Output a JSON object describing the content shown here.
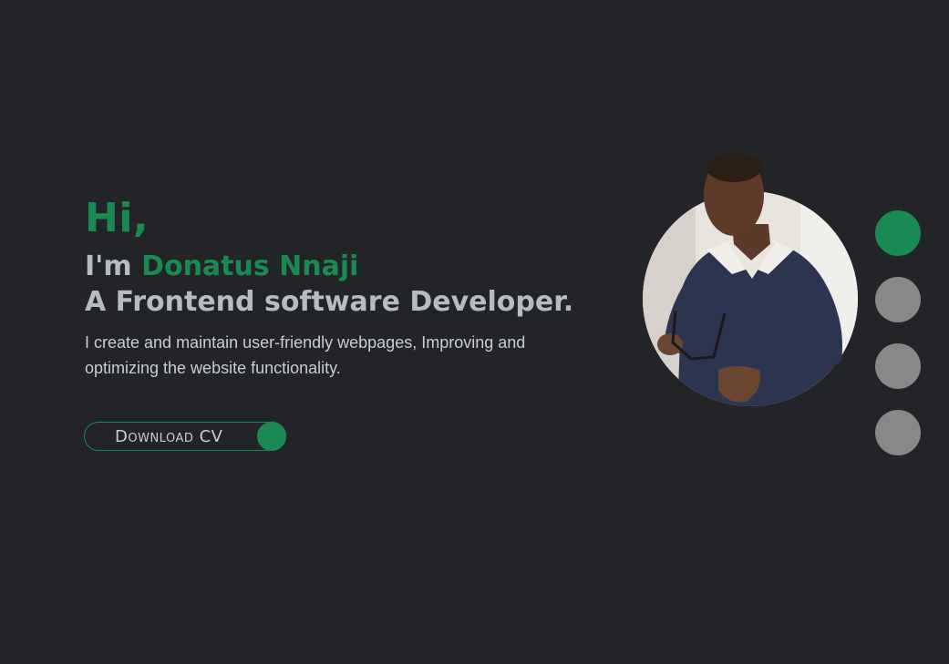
{
  "hero": {
    "greeting": "Hi,",
    "intro_prefix": "I'm",
    "name": "Donatus Nnaji",
    "role": "A Frontend software Developer.",
    "description": "I create and maintain user-friendly webpages, Improving and optimizing the website functionality."
  },
  "cta": {
    "label": "Download CV"
  },
  "profile_photo": {
    "alt": "Donatus Nnaji"
  },
  "pagination": {
    "dots": 4,
    "active_index": 0
  },
  "colors": {
    "background": "#222428",
    "accent": "#1a8a52",
    "text": "#b7bcc2",
    "inactive_dot": "#888888"
  }
}
